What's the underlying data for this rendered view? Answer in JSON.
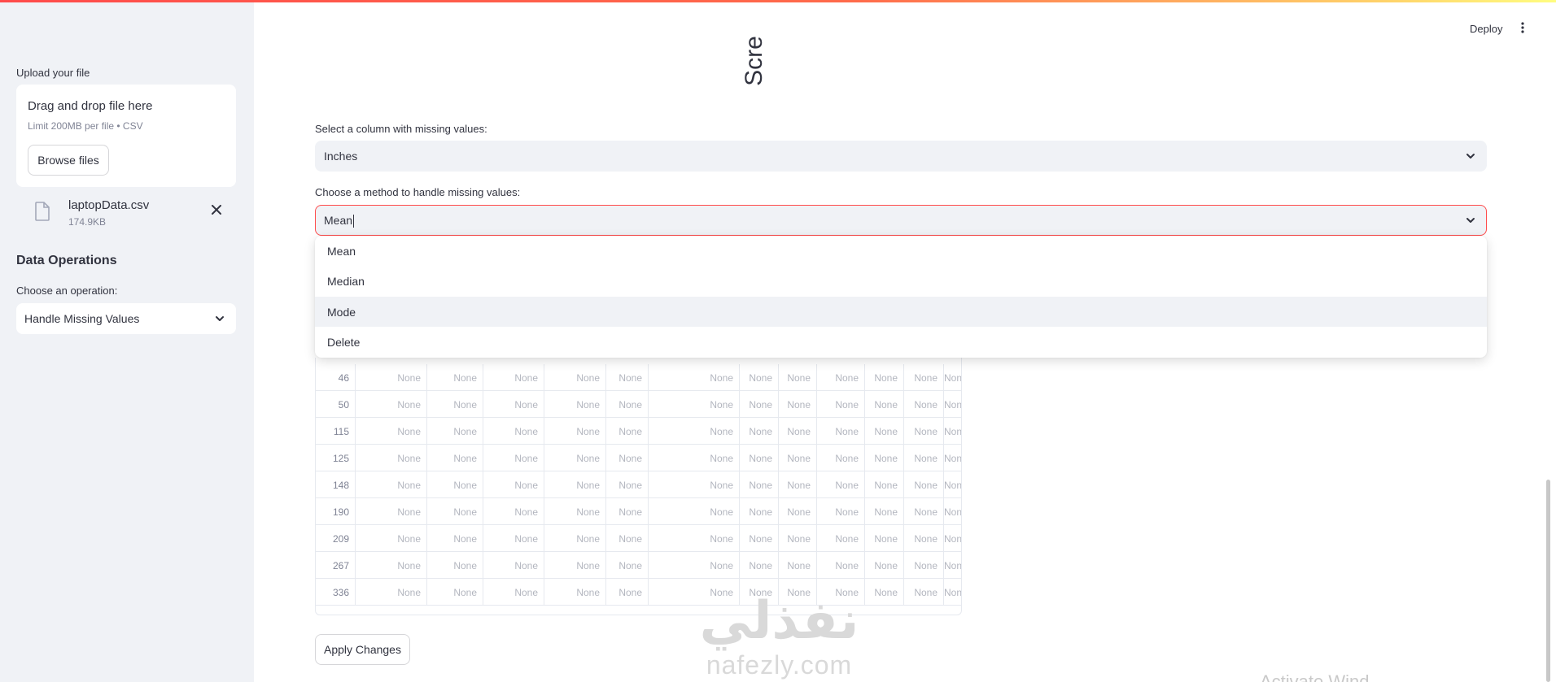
{
  "sidebar": {
    "upload_label": "Upload your file",
    "uploader_title": "Drag and drop file here",
    "uploader_sub": "Limit 200MB per file • CSV",
    "browse_label": "Browse files",
    "file_name": "laptopData.csv",
    "file_size": "174.9KB",
    "heading": "Data Operations",
    "operation_label": "Choose an operation:",
    "operation_value": "Handle Missing Values"
  },
  "header": {
    "deploy_label": "Deploy",
    "partial_title": "Scre"
  },
  "main": {
    "column_label": "Select a column with missing values:",
    "column_value": "Inches",
    "method_label": "Choose a method to handle missing values:",
    "method_value": "Mean",
    "method_options": [
      "Mean",
      "Median",
      "Mode",
      "Delete"
    ],
    "hovered_option": "Mode",
    "apply_label": "Apply Changes"
  },
  "table": {
    "rows": [
      {
        "index": "46",
        "cells": [
          "None",
          "None",
          "None",
          "None",
          "None",
          "None",
          "None",
          "None",
          "None",
          "None",
          "None",
          "None"
        ]
      },
      {
        "index": "50",
        "cells": [
          "None",
          "None",
          "None",
          "None",
          "None",
          "None",
          "None",
          "None",
          "None",
          "None",
          "None",
          "None"
        ]
      },
      {
        "index": "115",
        "cells": [
          "None",
          "None",
          "None",
          "None",
          "None",
          "None",
          "None",
          "None",
          "None",
          "None",
          "None",
          "None"
        ]
      },
      {
        "index": "125",
        "cells": [
          "None",
          "None",
          "None",
          "None",
          "None",
          "None",
          "None",
          "None",
          "None",
          "None",
          "None",
          "None"
        ]
      },
      {
        "index": "148",
        "cells": [
          "None",
          "None",
          "None",
          "None",
          "None",
          "None",
          "None",
          "None",
          "None",
          "None",
          "None",
          "None"
        ]
      },
      {
        "index": "190",
        "cells": [
          "None",
          "None",
          "None",
          "None",
          "None",
          "None",
          "None",
          "None",
          "None",
          "None",
          "None",
          "None"
        ]
      },
      {
        "index": "209",
        "cells": [
          "None",
          "None",
          "None",
          "None",
          "None",
          "None",
          "None",
          "None",
          "None",
          "None",
          "None",
          "None"
        ]
      },
      {
        "index": "267",
        "cells": [
          "None",
          "None",
          "None",
          "None",
          "None",
          "None",
          "None",
          "None",
          "None",
          "None",
          "None",
          "None"
        ]
      },
      {
        "index": "336",
        "cells": [
          "None",
          "None",
          "None",
          "None",
          "None",
          "None",
          "None",
          "None",
          "None",
          "None",
          "None",
          "None"
        ]
      }
    ]
  },
  "watermark": {
    "arabic": "نفذلي",
    "latin": "nafezly.com"
  },
  "overlay": {
    "activate_text": "Activate Wind"
  },
  "colors": {
    "accent": "#ff4b4b",
    "sidebar_bg": "#f0f2f6",
    "text": "#31333f",
    "muted": "#808495"
  }
}
